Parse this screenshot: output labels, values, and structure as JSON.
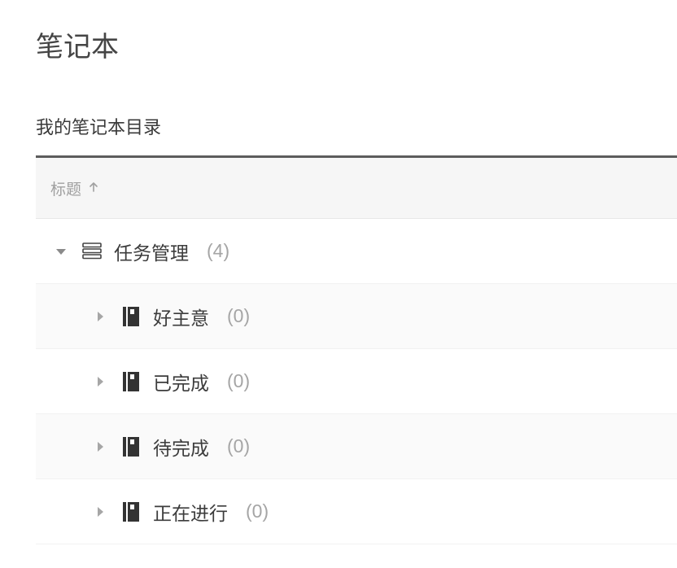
{
  "page_title": "笔记本",
  "section_title": "我的笔记本目录",
  "column_label": "标题",
  "sort_direction": "asc",
  "rows": [
    {
      "level": 0,
      "expanded": true,
      "type": "stack",
      "name": "任务管理",
      "count": 4
    },
    {
      "level": 1,
      "expanded": false,
      "type": "notebook",
      "name": "好主意",
      "count": 0
    },
    {
      "level": 1,
      "expanded": false,
      "type": "notebook",
      "name": "已完成",
      "count": 0
    },
    {
      "level": 1,
      "expanded": false,
      "type": "notebook",
      "name": "待完成",
      "count": 0
    },
    {
      "level": 1,
      "expanded": false,
      "type": "notebook",
      "name": "正在进行",
      "count": 0
    }
  ]
}
